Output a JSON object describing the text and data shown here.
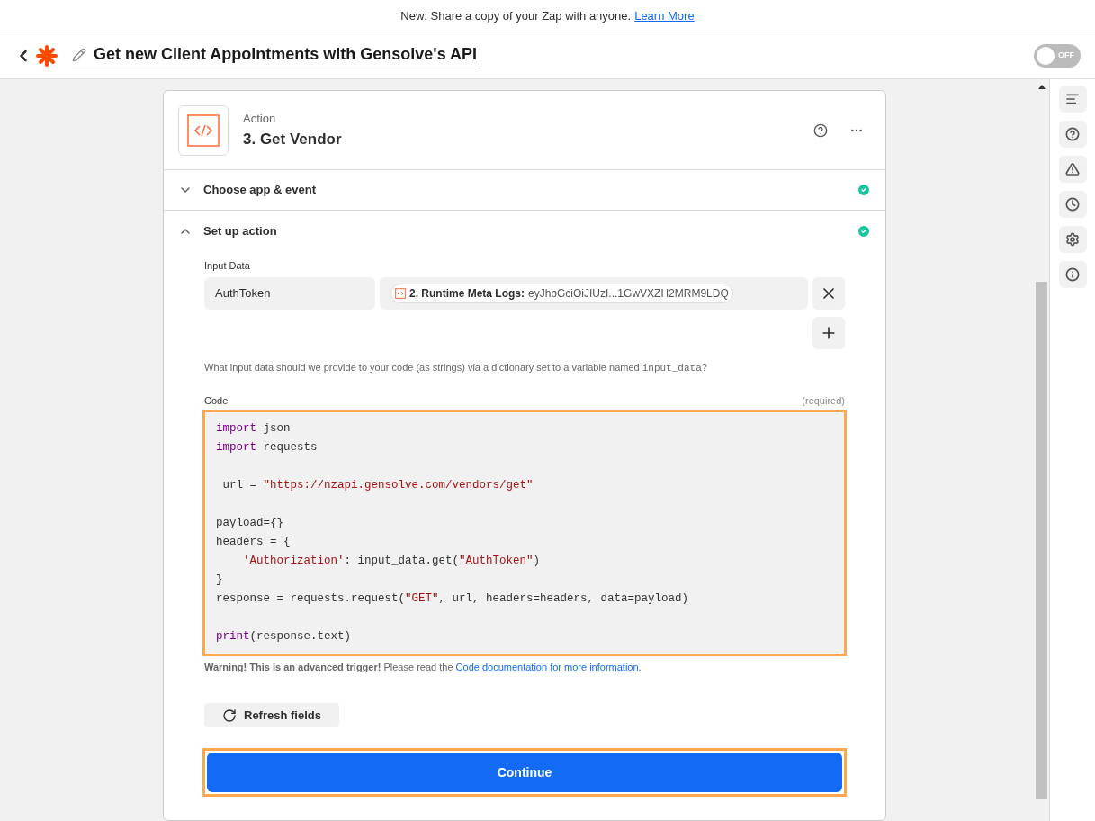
{
  "banner": {
    "text": "New: Share a copy of your Zap with anyone.",
    "link": "Learn More"
  },
  "header": {
    "title": "Get new Client Appointments with Gensolve's API",
    "toggle": {
      "on": false,
      "label": "OFF"
    }
  },
  "step": {
    "kind_label": "Action",
    "title": "3. Get Vendor"
  },
  "sections": [
    {
      "title": "Choose app & event",
      "expanded": false,
      "complete": true
    },
    {
      "title": "Set up action",
      "expanded": true,
      "complete": true
    }
  ],
  "input_data": {
    "label": "Input Data",
    "rows": [
      {
        "key": "AuthToken",
        "pill_source": "2. Runtime Meta Logs:",
        "pill_value": "eyJhbGciOiJIUzI...1GwVXZH2MRM9LDQ"
      }
    ],
    "help_before": "What input data should we provide to your code (as strings) via a dictionary set to a variable named",
    "help_code": "input_data",
    "help_after": "?"
  },
  "code": {
    "label": "Code",
    "required": "(required)",
    "lines": [
      {
        "segments": [
          {
            "kind": "kw",
            "text": "import"
          },
          {
            "kind": "plain",
            "text": " json"
          }
        ]
      },
      {
        "segments": [
          {
            "kind": "kw",
            "text": "import"
          },
          {
            "kind": "plain",
            "text": " requests"
          }
        ]
      },
      {
        "kind": "blank"
      },
      {
        "segments": [
          {
            "kind": "plain",
            "text": " url = "
          },
          {
            "kind": "str",
            "text": "\"https://nzapi.gensolve.com/vendors/get\""
          }
        ]
      },
      {
        "kind": "blank"
      },
      {
        "segments": [
          {
            "kind": "plain",
            "text": "payload={}"
          }
        ]
      },
      {
        "segments": [
          {
            "kind": "plain",
            "text": "headers = {"
          }
        ]
      },
      {
        "segments": [
          {
            "kind": "str",
            "text": "    'Authorization'"
          },
          {
            "kind": "plain",
            "text": ": input_data.get("
          },
          {
            "kind": "str",
            "text": "\"AuthToken\""
          },
          {
            "kind": "plain",
            "text": ")"
          }
        ]
      },
      {
        "segments": [
          {
            "kind": "plain",
            "text": "}"
          }
        ]
      },
      {
        "segments": [
          {
            "kind": "plain",
            "text": "response = requests.request("
          },
          {
            "kind": "str",
            "text": "\"GET\""
          },
          {
            "kind": "plain",
            "text": ", url, headers=headers, data=payload)"
          }
        ]
      },
      {
        "kind": "blank"
      },
      {
        "segments": [
          {
            "kind": "kw",
            "text": "print"
          },
          {
            "kind": "plain",
            "text": "(response.text)"
          }
        ]
      }
    ],
    "warning_bold": "Warning! This is an advanced trigger!",
    "warning_text": "Please read the",
    "warning_link": "Code documentation for more information",
    "warning_end": "."
  },
  "refresh_button": "Refresh fields",
  "continue_button": "Continue",
  "side_tools": [
    {
      "kind": "notes"
    },
    {
      "kind": "help"
    },
    {
      "kind": "warning"
    },
    {
      "kind": "history"
    },
    {
      "kind": "settings"
    },
    {
      "kind": "info"
    }
  ]
}
